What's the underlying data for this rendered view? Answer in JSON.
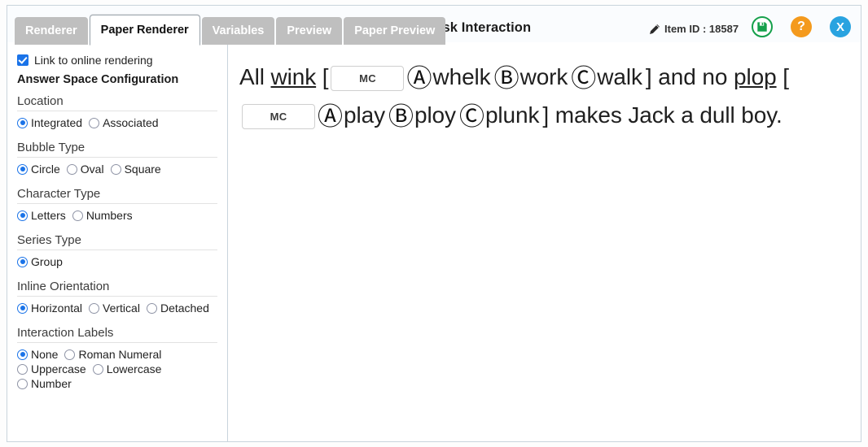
{
  "header": {
    "title": "Edit Task Interaction",
    "item_id_label": "Item ID : 18587",
    "pencil_icon": "pencil-icon",
    "buttons": [
      {
        "name": "save-button",
        "icon": "floppy-disk-icon",
        "glyph": "▣",
        "color": "#15a04b"
      },
      {
        "name": "help-button",
        "icon": "question-mark-icon",
        "glyph": "?",
        "color": "#f49a1d"
      },
      {
        "name": "close-button",
        "icon": "close-x-icon",
        "glyph": "X",
        "color": "#29a3e0"
      }
    ]
  },
  "tabs": [
    {
      "label": "Renderer",
      "active": false
    },
    {
      "label": "Paper Renderer",
      "active": true
    },
    {
      "label": "Variables",
      "active": false
    },
    {
      "label": "Preview",
      "active": false
    },
    {
      "label": "Paper Preview",
      "active": false
    }
  ],
  "sidebar": {
    "link_checkbox": {
      "label": "Link to online rendering",
      "checked": true
    },
    "section_title": "Answer Space Configuration",
    "groups": [
      {
        "label": "Location",
        "lines": [
          [
            {
              "label": "Integrated",
              "checked": true
            },
            {
              "label": "Associated",
              "checked": false
            }
          ]
        ]
      },
      {
        "label": "Bubble Type",
        "lines": [
          [
            {
              "label": "Circle",
              "checked": true
            },
            {
              "label": "Oval",
              "checked": false
            },
            {
              "label": "Square",
              "checked": false
            }
          ]
        ]
      },
      {
        "label": "Character Type",
        "lines": [
          [
            {
              "label": "Letters",
              "checked": true
            },
            {
              "label": "Numbers",
              "checked": false
            }
          ]
        ]
      },
      {
        "label": "Series Type",
        "lines": [
          [
            {
              "label": "Group",
              "checked": true
            }
          ]
        ]
      },
      {
        "label": "Inline Orientation",
        "lines": [
          [
            {
              "label": "Horizontal",
              "checked": true
            },
            {
              "label": "Vertical",
              "checked": false
            },
            {
              "label": "Detached",
              "checked": false
            }
          ]
        ]
      },
      {
        "label": "Interaction Labels",
        "lines": [
          [
            {
              "label": "None",
              "checked": true
            },
            {
              "label": "Roman Numeral",
              "checked": false
            }
          ],
          [
            {
              "label": "Uppercase",
              "checked": false
            },
            {
              "label": "Lowercase",
              "checked": false
            }
          ],
          [
            {
              "label": "Number",
              "checked": false
            }
          ]
        ]
      }
    ]
  },
  "content": {
    "stem_parts": {
      "lead": "All ",
      "blank1": "wink",
      "open_bracket1": " [",
      "mc_box_label": "MC",
      "bubble_a": "Ⓐ",
      "opt_a1": "whelk",
      "bubble_b": "Ⓑ",
      "opt_b1": "work",
      "bubble_c": "Ⓒ",
      "opt_c1": "walk",
      "close_bracket1": "] and no ",
      "blank2": "plop",
      "open_bracket2": " [",
      "opt_a2": "play",
      "opt_b2": "ploy",
      "opt_c2": "plunk",
      "close_bracket2": "] makes Jack a dull boy."
    }
  }
}
